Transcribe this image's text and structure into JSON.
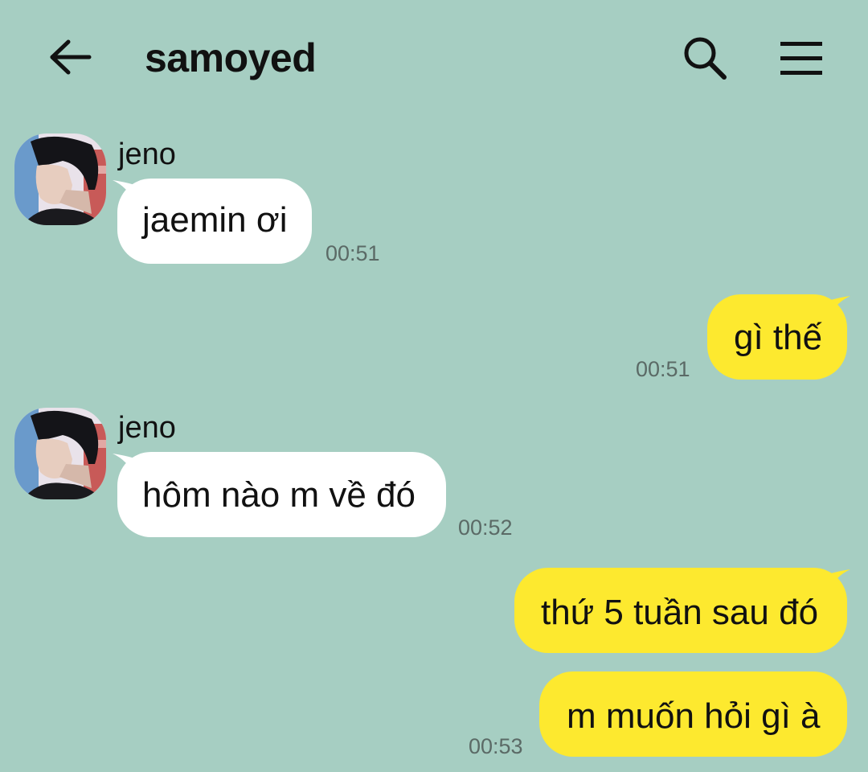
{
  "header": {
    "title": "samoyed",
    "back_icon": "arrow-left-icon",
    "search_icon": "search-icon",
    "menu_icon": "hamburger-menu-icon"
  },
  "colors": {
    "background": "#a6cec2",
    "incoming_bubble": "#ffffff",
    "outgoing_bubble": "#fde92f",
    "timestamp": "#5b6a66"
  },
  "messages": [
    {
      "direction": "incoming",
      "sender": "jeno",
      "text": "jaemin ơi",
      "time": "00:51"
    },
    {
      "direction": "outgoing",
      "text": "gì thế",
      "time": "00:51"
    },
    {
      "direction": "incoming",
      "sender": "jeno",
      "text": "hôm nào m về đó",
      "time": "00:52"
    },
    {
      "direction": "outgoing",
      "text": "thứ 5 tuần sau đó",
      "time": ""
    },
    {
      "direction": "outgoing",
      "text": "m muốn hỏi gì à",
      "time": "00:53"
    }
  ]
}
